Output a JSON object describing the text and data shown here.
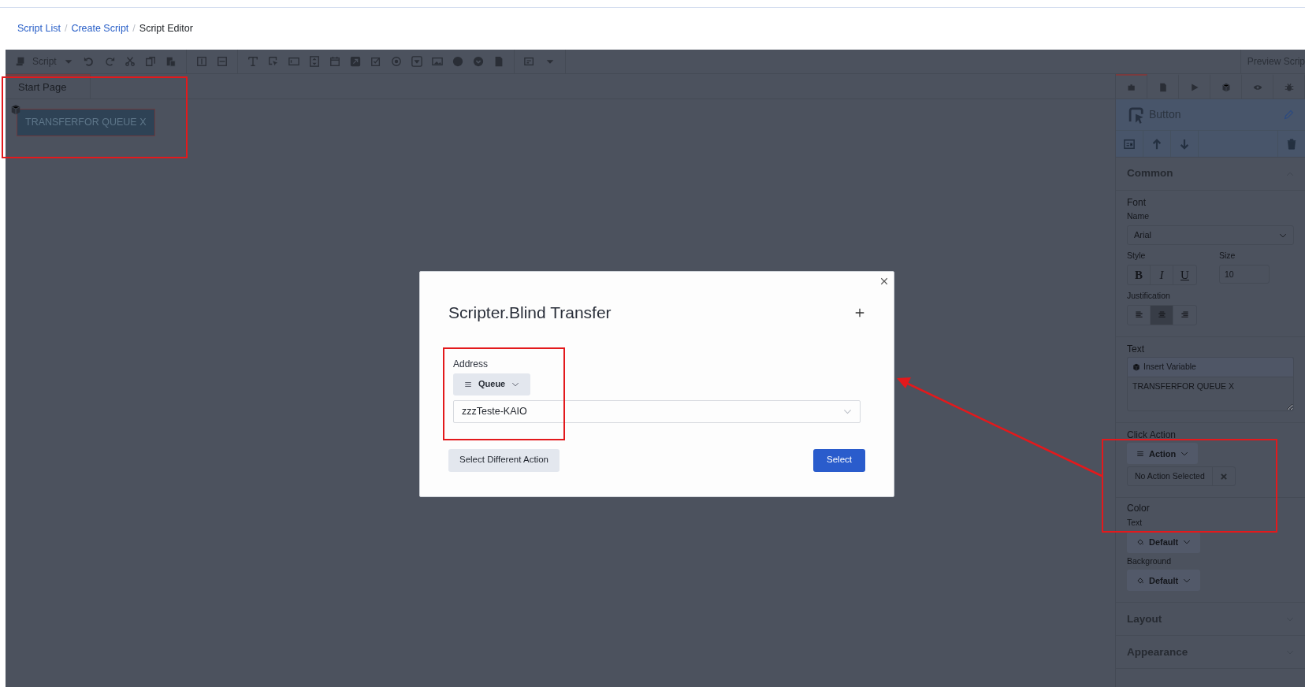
{
  "breadcrumb": {
    "separator": "/",
    "items": [
      {
        "label": "Script List",
        "link": true
      },
      {
        "label": "Create Script",
        "link": true
      },
      {
        "label": "Script Editor",
        "link": false
      }
    ]
  },
  "toolbar": {
    "script_menu": "Script",
    "preview": "Preview Scrip"
  },
  "pages": [
    {
      "label": "Start Page",
      "selected": true
    }
  ],
  "canvas": {
    "button_text": "TRANSFERFOR QUEUE X"
  },
  "panel": {
    "tabs": [
      {
        "selected": true
      },
      {
        "selected": false
      },
      {
        "selected": false
      },
      {
        "selected": false
      },
      {
        "selected": false
      },
      {
        "selected": false
      }
    ],
    "component": "Button",
    "sections": [
      {
        "title": "Common",
        "expanded": true
      },
      {
        "title": "Layout",
        "expanded": false
      },
      {
        "title": "Appearance",
        "expanded": false
      }
    ],
    "font_label": "Font",
    "name_label": "Name",
    "font_name": "Arial",
    "style_label": "Style",
    "style_buttons": [
      "B",
      "I",
      "U"
    ],
    "size_label": "Size",
    "size": "10",
    "justification_label": "Justification",
    "justification": [
      {
        "selected": false
      },
      {
        "selected": true
      },
      {
        "selected": false
      }
    ],
    "text_label": "Text",
    "insert_variable": "Insert Variable",
    "text_value": "TRANSFERFOR QUEUE X",
    "click_action_label": "Click Action",
    "action_menu": "Action",
    "action_value": "No Action Selected",
    "color_label": "Color",
    "text_color_label": "Text",
    "text_color": "Default",
    "background_label": "Background",
    "background_color": "Default"
  },
  "modal": {
    "title": "Scripter.Blind Transfer",
    "address_label": "Address",
    "address_type": "Queue",
    "address_value": "zzzTeste-KAIO",
    "secondary_button": "Select Different Action",
    "primary_button": "Select"
  }
}
